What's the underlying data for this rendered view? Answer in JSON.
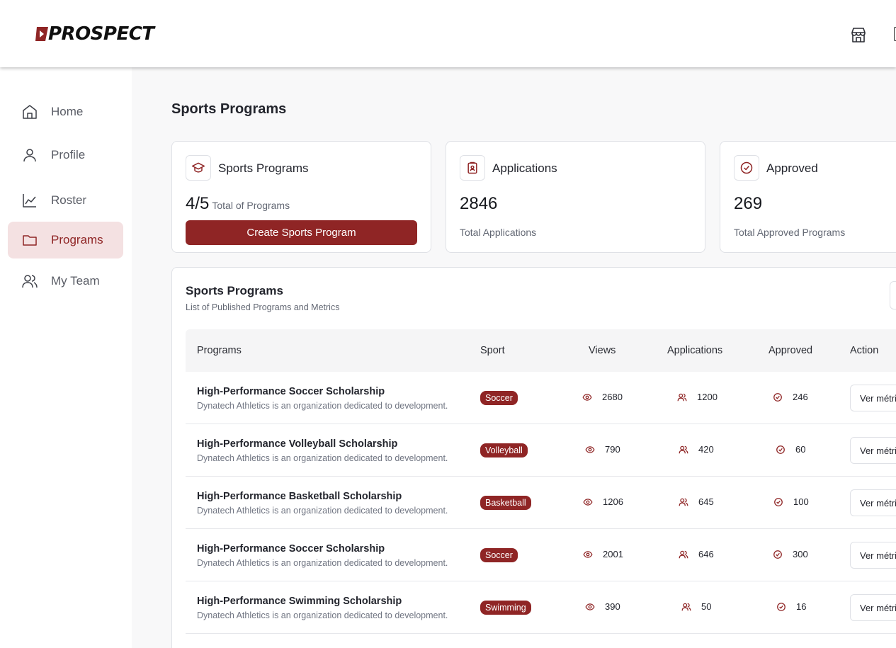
{
  "brand": {
    "logo_text": "PROSPECT",
    "accent": "#8f2525",
    "active_bg": "#f4e1e2"
  },
  "header": {
    "icons": [
      "store-icon"
    ]
  },
  "sidebar": {
    "items": [
      {
        "label": "Home",
        "icon": "home-icon",
        "active": false
      },
      {
        "label": "Profile",
        "icon": "user-icon",
        "active": false
      },
      {
        "label": "Roster",
        "icon": "chart-icon",
        "active": false
      },
      {
        "label": "Programs",
        "icon": "folder-icon",
        "active": true
      },
      {
        "label": "My Team",
        "icon": "team-icon",
        "active": false
      }
    ]
  },
  "main": {
    "title": "Sports Programs",
    "cards": [
      {
        "title": "Sports Programs",
        "value": "4/5",
        "sub": "Total of Programs",
        "icon": "graduation-cap-icon",
        "button": "Create Sports Program"
      },
      {
        "title": "Applications",
        "value": "2846",
        "sub": "Total Applications",
        "icon": "clipboard-user-icon"
      },
      {
        "title": "Approved",
        "value": "269",
        "sub": "Total Approved Programs",
        "icon": "check-circle-icon"
      }
    ],
    "table": {
      "title": "Sports Programs",
      "subtitle": "List of Published Programs and Metrics",
      "columns": [
        "Programs",
        "Sport",
        "Views",
        "Applications",
        "Approved",
        "Action"
      ],
      "rows": [
        {
          "name": "High-Performance Soccer Scholarship",
          "desc": "Dynatech Athletics is an organization dedicated to development.",
          "sport": "Soccer",
          "views": "2680",
          "applications": "1200",
          "approved": "246",
          "action": "Ver métricas"
        },
        {
          "name": "High-Performance Volleyball Scholarship",
          "desc": "Dynatech Athletics is an organization dedicated to development.",
          "sport": "Volleyball",
          "views": "790",
          "applications": "420",
          "approved": "60",
          "action": "Ver métricas"
        },
        {
          "name": "High-Performance Basketball Scholarship",
          "desc": "Dynatech Athletics is an organization dedicated to development.",
          "sport": "Basketball",
          "views": "1206",
          "applications": "645",
          "approved": "100",
          "action": "Ver métricas"
        },
        {
          "name": "High-Performance Soccer Scholarship",
          "desc": "Dynatech Athletics is an organization dedicated to development.",
          "sport": "Soccer",
          "views": "2001",
          "applications": "646",
          "approved": "300",
          "action": "Ver métricas"
        },
        {
          "name": "High-Performance Swimming Scholarship",
          "desc": "Dynatech Athletics is an organization dedicated to development.",
          "sport": "Swimming",
          "views": "390",
          "applications": "50",
          "approved": "16",
          "action": "Ver métricas"
        }
      ]
    }
  }
}
